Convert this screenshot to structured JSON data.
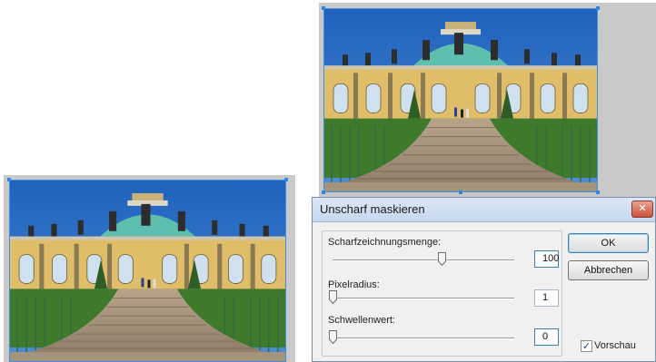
{
  "dialog": {
    "title": "Unscharf maskieren",
    "close_icon": "close-icon",
    "sliders": [
      {
        "label": "Scharfzeichnungsmenge:",
        "value": "100",
        "level": 0.6
      },
      {
        "label": "Pixelradius:",
        "value": "1",
        "level": 0.0
      },
      {
        "label": "Schwellenwert:",
        "value": "0",
        "level": 0.0
      }
    ],
    "ok_label": "OK",
    "cancel_label": "Abbrechen",
    "preview": {
      "label": "Vorschau",
      "checked": true
    }
  },
  "colors": {
    "selection_border": "#3d8fe0",
    "sky": "#2e6fc4",
    "dome": "#5fbfae",
    "facade": "#e0be69"
  }
}
